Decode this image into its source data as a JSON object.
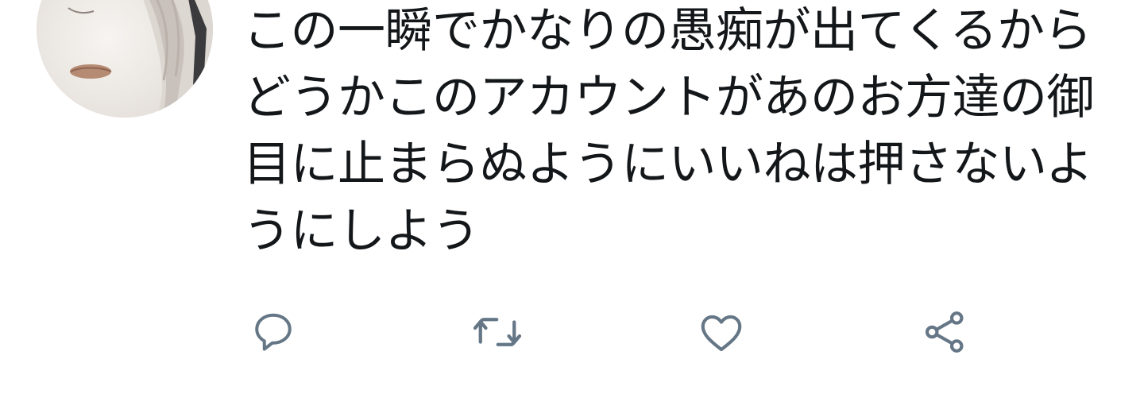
{
  "tweet": {
    "text": "この一瞬でかなりの愚痴が出てくるから\nどうかこのアカウントがあのお方達の御\n目に止まらぬようにいいねは押さないよ\nうにしよう"
  },
  "avatar": {
    "icon": "profile-avatar"
  },
  "actions": {
    "reply_icon": "reply-icon",
    "retweet_icon": "retweet-icon",
    "like_icon": "heart-icon",
    "share_icon": "share-icon",
    "icon_color": "#657786"
  }
}
